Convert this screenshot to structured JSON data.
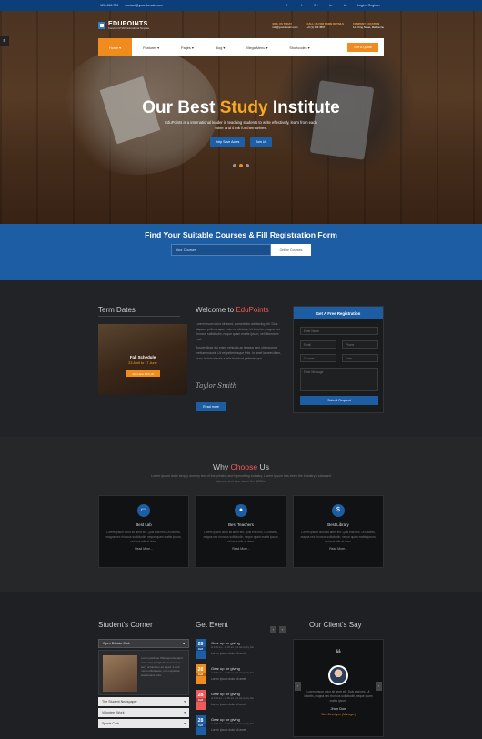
{
  "topbar": {
    "phone": "123-456-789",
    "email": "contact@yourdomain.com",
    "social": [
      "f",
      "t",
      "G+",
      "in",
      "in"
    ],
    "login": "Login / Register"
  },
  "header": {
    "logo_text": "EDUPOINTS",
    "logo_sub": "Standard HTML5 Educational Template",
    "contacts": [
      {
        "title": "MAIL US TODAY",
        "value": "info@yourdomain.com"
      },
      {
        "title": "CALL US FOR MORE DETAILS",
        "value": "+0 (1) 123 4567"
      },
      {
        "title": "COMPANY LOCATION",
        "value": "121 King Street, Melbourne"
      }
    ]
  },
  "nav": {
    "items": [
      "Home ▾",
      "Features ▾",
      "Pages ▾",
      "Blog ▾",
      "Mega Menu ▾",
      "Shortcodes ▾"
    ],
    "quote": "Get A Quote"
  },
  "hero": {
    "title_pre": "Our Best ",
    "title_accent": "Study",
    "title_post": " Institute",
    "desc": "EduPoints is a international leader in teaching students to write effectively, learn from each other and think for themselves.",
    "btn1": "Help Save Acres",
    "btn2": "Join Us"
  },
  "registration": {
    "title": "Find Your Suitable Courses & Fill Registration Form",
    "placeholder": "Your Courses",
    "button": "Online Courses"
  },
  "term": {
    "title": "Term Dates",
    "caption": "Fall Schedule",
    "dates": "23 April to 17 June",
    "button": "Join Here 30% off"
  },
  "welcome": {
    "title_pre": "Welcome to ",
    "title_accent": "EduPoints",
    "p1": "Lorem ipsum dolor sit amet, consectetur adipiscing elit. Duis aliquam pellentesque enim ne ultricies. Ut lobortis, magna nec rhoncus sollicitudin, neque quam mattis ipsum, vel bibendum erat.",
    "p2": "Suspendisse dui enim, vehicula ac tempus sed, ullamcorper pretium mauris. Ut vel pellentesque felis. In amet laoreet diam, Nunc lacinia mauris a felis tincidunt pellentesque.",
    "signature": "Taylor Smith",
    "button": "Read more"
  },
  "regform": {
    "title": "Get A Free Registration",
    "name": "Enter Name",
    "email": "Email",
    "phone": "Phone",
    "courses": "Courses",
    "date": "Date",
    "message": "Enter Message",
    "submit": "Submit Request"
  },
  "why": {
    "title_pre": "Why ",
    "title_accent": "Choose",
    "title_post": " Us",
    "desc": "Lorem ipsum dolor simply dummy text of the printing and typesetting industry. Lorem Ipsum has been the industry's standard dummy text ever since the 1500s.",
    "cards": [
      {
        "icon": "monitor-icon",
        "title": "Best Lab",
        "desc": "Lorem ipsum dolor sit amet elit. Quis erat nec. Ut lobortis, magna nec rhoncus sollicitudin, neque quam mattis ipsum, vel erat with at diam.",
        "more": "Read More..."
      },
      {
        "icon": "user-icon",
        "title": "Best Teachers",
        "desc": "Lorem ipsum dolor sit amet elit. Quis erat nec. Ut lobortis, magna nec rhoncus sollicitudin, neque quam mattis ipsum, vel erat with at diam.",
        "more": "Read More..."
      },
      {
        "icon": "money-icon",
        "title": "Best Library",
        "desc": "Lorem ipsum dolor sit amet elit. Quis erat nec. Ut lobortis, magna nec rhoncus sollicitudin, neque quam mattis ipsum, vel erat with at diam.",
        "more": "Read More..."
      }
    ]
  },
  "corner": {
    "title": "Student's Corner",
    "active": "Open Debate Club",
    "active_text": "Lorem partique Ollie reprehenderit. Anim aliquip high life accusamus terry richardson ad squid. 3 wolf moon officia aute, non cupidatat skateboard dolor.",
    "items": [
      "The Student Newspaper",
      "Volunteer Work",
      "Sports Club"
    ]
  },
  "events": {
    "title": "Get Event",
    "items": [
      {
        "day": "28",
        "month": "FEB",
        "color": "#1d5da3",
        "title": "Gear up for giving",
        "meta": "at 9:00 am - 11:00 am  |  12 Hemputty Dar",
        "desc": "Lorem ipsum dolor sit amet."
      },
      {
        "day": "28",
        "month": "FEB",
        "color": "#f08c1e",
        "title": "Gear up for giving",
        "meta": "at 9:00 am - 11:00 am  |  12 Hemputty Dar",
        "desc": "Lorem ipsum dolor sit amet."
      },
      {
        "day": "28",
        "month": "FEB",
        "color": "#ef5a5a",
        "title": "Gear up for giving",
        "meta": "at 9:00 am - 11:00 am  |  12 Hemputty Dar",
        "desc": "Lorem ipsum dolor sit amet."
      },
      {
        "day": "28",
        "month": "FEB",
        "color": "#1d5da3",
        "title": "Gear up for giving",
        "meta": "at 9:00 am - 11:00 am  |  12 Hemputty Dar",
        "desc": "Lorem ipsum dolor sit amet."
      }
    ]
  },
  "testimonial": {
    "title": "Our Client's Say",
    "quote": "Lorem ipsum dolor sit amet elit. Duis erat nec. Ut lobortis, magna nec rhoncus sollicitudin, neque quam mattis ipsum.",
    "name": "Jhon Doe",
    "role": "Web Developer (Manager)"
  }
}
